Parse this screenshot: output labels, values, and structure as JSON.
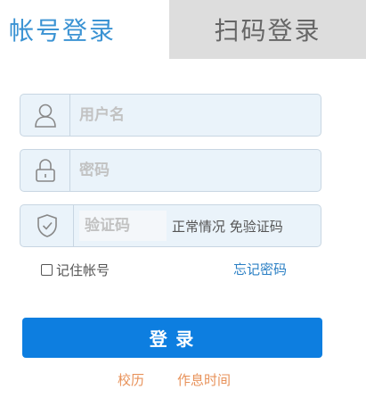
{
  "tabs": [
    {
      "label": "帐号登录",
      "active": true
    },
    {
      "label": "扫码登录",
      "active": false
    }
  ],
  "form": {
    "username": {
      "placeholder": "用户名",
      "value": ""
    },
    "password": {
      "placeholder": "密码",
      "value": ""
    },
    "captcha": {
      "placeholder": "验证码",
      "value": "",
      "hint": "正常情况 免验证码"
    }
  },
  "remember": {
    "label": "记住帐号",
    "checked": false
  },
  "forgot": {
    "label": "忘记密码"
  },
  "login_button": {
    "label": "登 录"
  },
  "footer_links": [
    {
      "label": "校历"
    },
    {
      "label": "作息时间"
    }
  ],
  "colors": {
    "accent": "#3b93d3",
    "button": "#0d7ee0",
    "link": "#2a7fc4",
    "footer_link": "#e8925a",
    "field_bg": "#eaf3fa",
    "tab_inactive_bg": "#dddddd"
  },
  "icons": {
    "username": "user-icon",
    "password": "lock-icon",
    "captcha": "shield-check-icon"
  }
}
